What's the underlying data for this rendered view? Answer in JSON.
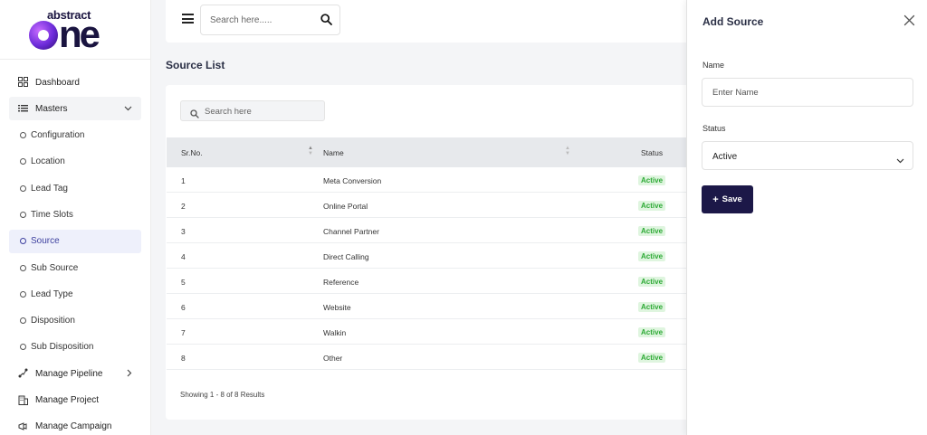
{
  "brand": {
    "top_word": "abstract",
    "main_word": "ne"
  },
  "sidebar": {
    "items": [
      {
        "label": "Dashboard",
        "icon": "grid-icon"
      },
      {
        "label": "Masters",
        "icon": "list-icon",
        "expanded": true
      },
      {
        "label": "Configuration"
      },
      {
        "label": "Location"
      },
      {
        "label": "Lead Tag"
      },
      {
        "label": "Time Slots"
      },
      {
        "label": "Source",
        "active": true
      },
      {
        "label": "Sub Source"
      },
      {
        "label": "Lead Type"
      },
      {
        "label": "Disposition"
      },
      {
        "label": "Sub Disposition"
      },
      {
        "label": "Manage Pipeline",
        "icon": "pipeline-icon"
      },
      {
        "label": "Manage Project",
        "icon": "building-icon"
      },
      {
        "label": "Manage Campaign",
        "icon": "campaign-icon"
      }
    ]
  },
  "topbar": {
    "search_placeholder": "Search here....."
  },
  "page": {
    "title": "Source List"
  },
  "list": {
    "search_placeholder": "Search here",
    "columns": {
      "sr": "Sr.No.",
      "name": "Name",
      "status": "Status"
    },
    "rows": [
      {
        "sr": "1",
        "name": "Meta Conversion",
        "status": "Active"
      },
      {
        "sr": "2",
        "name": "Online Portal",
        "status": "Active"
      },
      {
        "sr": "3",
        "name": "Channel Partner",
        "status": "Active"
      },
      {
        "sr": "4",
        "name": "Direct Calling",
        "status": "Active"
      },
      {
        "sr": "5",
        "name": "Reference",
        "status": "Active"
      },
      {
        "sr": "6",
        "name": "Website",
        "status": "Active"
      },
      {
        "sr": "7",
        "name": "Walkin",
        "status": "Active"
      },
      {
        "sr": "8",
        "name": "Other",
        "status": "Active"
      }
    ],
    "footer": "Showing 1 - 8 of 8 Results"
  },
  "panel": {
    "title": "Add Source",
    "name_label": "Name",
    "name_placeholder": "Enter Name",
    "status_label": "Status",
    "status_value": "Active",
    "save_label": "Save"
  },
  "colors": {
    "accent": "#1c1848",
    "active_nav_bg": "#eef0fb",
    "badge_bg": "#dff5df",
    "badge_text": "#2eaa36"
  }
}
